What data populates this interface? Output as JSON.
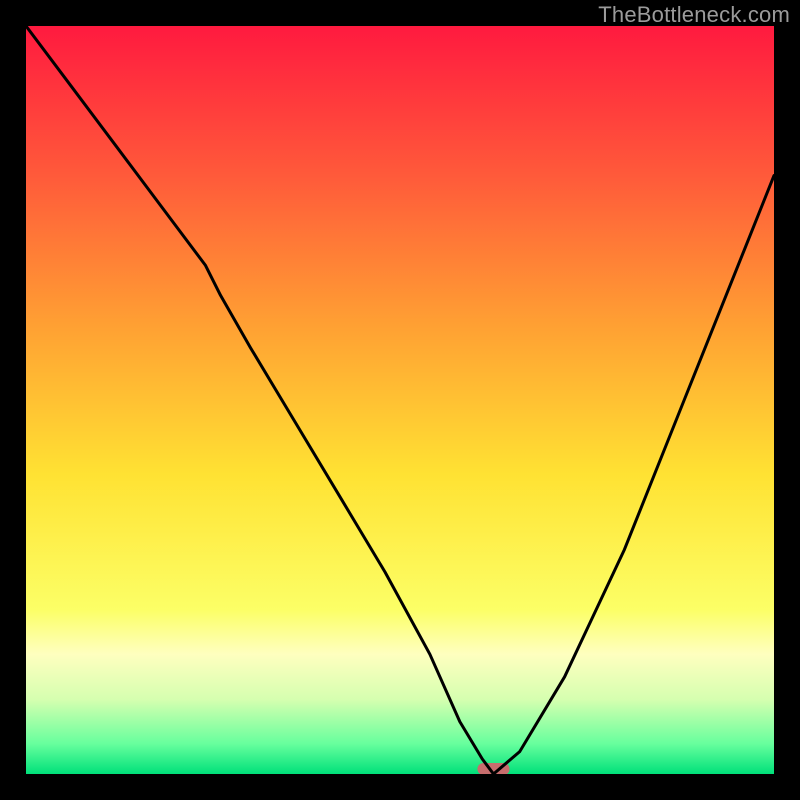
{
  "watermark": "TheBottleneck.com",
  "chart_data": {
    "type": "line",
    "title": "",
    "xlabel": "",
    "ylabel": "",
    "xlim": [
      0,
      100
    ],
    "ylim": [
      0,
      100
    ],
    "grid": false,
    "series": [
      {
        "name": "curve",
        "color": "#000000",
        "x": [
          0,
          6,
          12,
          18,
          24,
          26,
          30,
          36,
          42,
          48,
          54,
          58,
          61,
          62.5,
          66,
          72,
          80,
          88,
          96,
          100
        ],
        "values": [
          100,
          92,
          84,
          76,
          68,
          64,
          57,
          47,
          37,
          27,
          16,
          7,
          2,
          0,
          3,
          13,
          30,
          50,
          70,
          80
        ]
      }
    ],
    "optimal_marker": {
      "x": 62.5,
      "width": 4.3,
      "color": "#c76d6d"
    },
    "background_gradient": {
      "stops": [
        {
          "pos": 0.0,
          "color": "#ff1a3f"
        },
        {
          "pos": 0.2,
          "color": "#ff5a3a"
        },
        {
          "pos": 0.4,
          "color": "#ffa033"
        },
        {
          "pos": 0.6,
          "color": "#ffe233"
        },
        {
          "pos": 0.78,
          "color": "#fcff66"
        },
        {
          "pos": 0.84,
          "color": "#feffbf"
        },
        {
          "pos": 0.9,
          "color": "#d6ffb0"
        },
        {
          "pos": 0.96,
          "color": "#66ff9d"
        },
        {
          "pos": 1.0,
          "color": "#00e07a"
        }
      ]
    }
  }
}
